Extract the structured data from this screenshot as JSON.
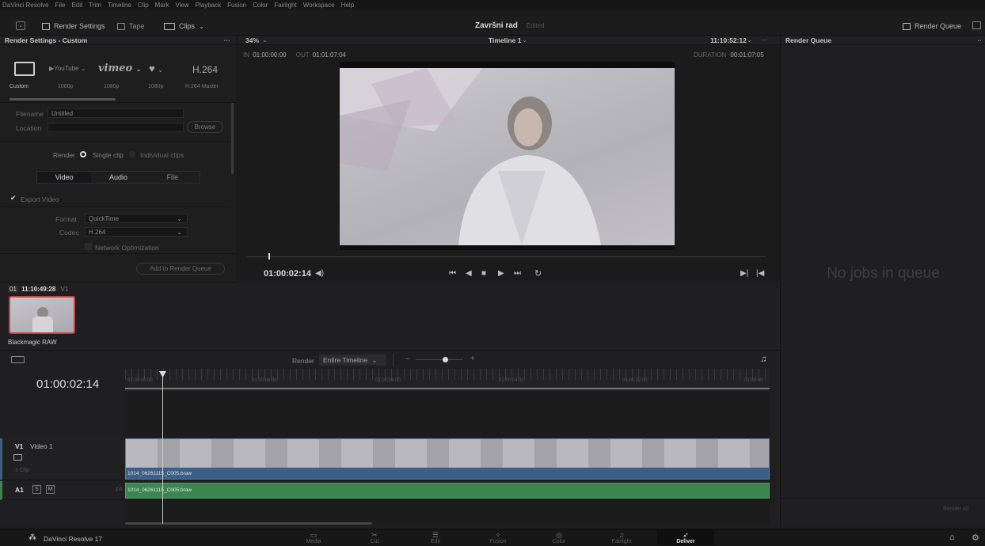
{
  "menubar": {
    "items": [
      "DaVinci Resolve",
      "File",
      "Edit",
      "Trim",
      "Timeline",
      "Clip",
      "Mark",
      "View",
      "Playback",
      "Fusion",
      "Color",
      "Fairlight",
      "Workspace",
      "Help"
    ]
  },
  "toolbar": {
    "render_settings": "Render Settings",
    "tape": "Tape",
    "clips": "Clips",
    "project_title": "Završni rad",
    "project_status": "Edited",
    "render_queue": "Render Queue"
  },
  "render_settings": {
    "header": "Render Settings - Custom",
    "presets": [
      {
        "label": "Custom",
        "icon": "custom-preset-icon"
      },
      {
        "label": "1080p",
        "icon": "youtube-logo",
        "logo_text": "▶YouTube"
      },
      {
        "label": "1080p",
        "icon": "vimeo-logo",
        "logo_text": "vimeo"
      },
      {
        "label": "1080p",
        "icon": "twitter-bird-icon"
      },
      {
        "label": "H.264 Master",
        "logo_text": "H.264"
      }
    ],
    "filename_label": "Filename",
    "filename_value": "Untitled",
    "location_label": "Location",
    "location_value": "",
    "browse": "Browse",
    "render_label": "Render",
    "single_clip": "Single clip",
    "individual_clips": "Individual clips",
    "tabs": [
      "Video",
      "Audio",
      "File"
    ],
    "export_video": "Export Video",
    "format_label": "Format",
    "format_value": "QuickTime",
    "codec_label": "Codec",
    "codec_value": "H.264",
    "network_opt": "Network Optimization",
    "add_to_queue": "Add to Render Queue"
  },
  "clip_bin": {
    "clip_no": "01",
    "timecode": "11:10:49:28",
    "track": "V1",
    "codec": "Blackmagic RAW"
  },
  "viewer": {
    "zoom": "34%",
    "timeline_name": "Timeline 1",
    "timecode_top": "11:10:52:12",
    "in_label": "IN",
    "in_value": "01:00:00:00",
    "out_label": "OUT",
    "out_value": "01:01:07:04",
    "duration_label": "DURATION",
    "duration_value": "00:01:07:05",
    "current_timecode": "01:00:02:14"
  },
  "render_queue": {
    "header": "Render Queue",
    "empty_text": "No jobs in queue",
    "render_all": "Render All"
  },
  "timeline": {
    "render_label": "Render",
    "render_range": "Entire Timeline",
    "timecode": "01:00:02:14",
    "ruler_ticks": [
      "01:00:00:00",
      "01:00:08:00",
      "01:00:16:00",
      "01:00:24:00",
      "01:00:32:00",
      "01:00:40"
    ],
    "v1_label": "V1",
    "v1_name": "Video 1",
    "v1_count": "1 Clip",
    "a1_label": "A1",
    "a1_s": "S",
    "a1_m": "M",
    "a1_channels": "2.0",
    "video_clip_name": "1014_06261115_C005.braw",
    "audio_clip_name": "1014_06261115_C005.braw"
  },
  "pagebar": {
    "app_name": "DaVinci Resolve 17",
    "pages": [
      "Media",
      "Cut",
      "Edit",
      "Fusion",
      "Color",
      "Fairlight",
      "Deliver"
    ],
    "active_page": "Deliver"
  }
}
